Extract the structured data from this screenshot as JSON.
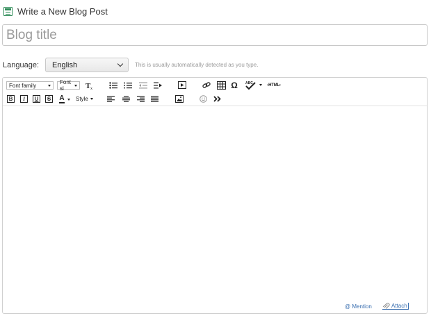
{
  "header": {
    "title": "Write a New Blog Post",
    "icon": "blog-post-icon"
  },
  "title_input": {
    "placeholder": "Blog title",
    "value": ""
  },
  "language": {
    "label": "Language:",
    "selected": "English",
    "hint": "This is usually automatically detected as you type."
  },
  "toolbar": {
    "font_family": "Font family",
    "font_size": "Font si",
    "bold": "B",
    "italic": "I",
    "underline": "U",
    "strike": "S",
    "text_color": "A",
    "style": "Style",
    "html": "‹HTML›",
    "spell": "ABC"
  },
  "footer": {
    "mention": "@ Mention",
    "attach": "Attach"
  },
  "colors": {
    "accent": "#2e8b57",
    "link": "#3a6fb0",
    "border": "#c8c8c8"
  }
}
